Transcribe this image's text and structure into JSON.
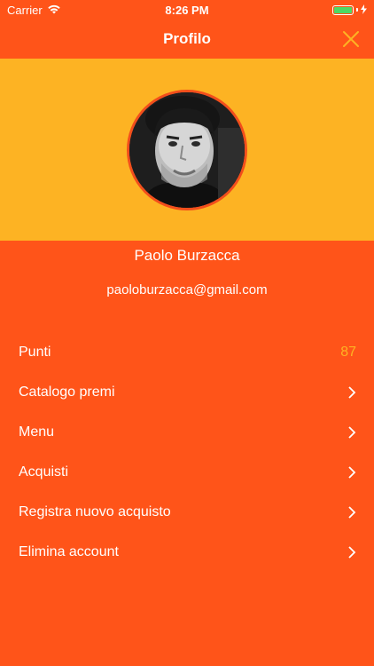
{
  "status_bar": {
    "carrier": "Carrier",
    "time": "8:26 PM"
  },
  "nav": {
    "title": "Profilo",
    "close_icon": "close-icon"
  },
  "profile": {
    "name": "Paolo Burzacca",
    "email": "paoloburzacca@gmail.com"
  },
  "menu": {
    "items": [
      {
        "label": "Punti",
        "value": "87"
      },
      {
        "label": "Catalogo premi"
      },
      {
        "label": "Menu"
      },
      {
        "label": "Acquisti"
      },
      {
        "label": "Registra nuovo acquisto"
      },
      {
        "label": "Elimina account"
      }
    ]
  },
  "colors": {
    "background": "#FF5419",
    "header_band": "#FDB323",
    "accent": "#FDB323",
    "battery": "#4CD964"
  }
}
